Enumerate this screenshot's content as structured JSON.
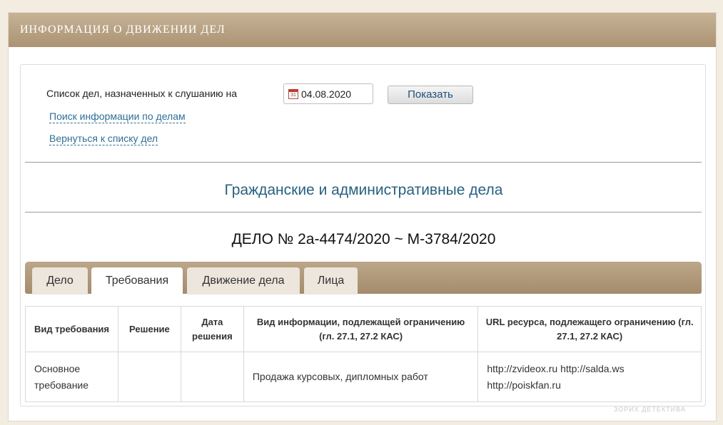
{
  "header": {
    "title": "ИНФОРМАЦИЯ О ДВИЖЕНИИ ДЕЛ"
  },
  "filter": {
    "label": "Список дел, назначенных к слушанию на",
    "date_value": "04.08.2020",
    "calendar_glyph": "31",
    "show_button": "Показать"
  },
  "links": {
    "search": "Поиск информации по делам",
    "back": "Вернуться к списку дел"
  },
  "section_title": "Гражданские и административные дела",
  "case_title": "ДЕЛО № 2а-4474/2020 ~ М-3784/2020",
  "tabs": [
    {
      "label": "Дело",
      "active": false
    },
    {
      "label": "Требования",
      "active": true
    },
    {
      "label": "Движение дела",
      "active": false
    },
    {
      "label": "Лица",
      "active": false
    }
  ],
  "table": {
    "headers": [
      "Вид требования",
      "Решение",
      "Дата решения",
      "Вид информации, подлежащей ограничению (гл. 27.1, 27.2 КАС)",
      "URL ресурса, подлежащего ограничению (гл. 27.1, 27.2 КАС)"
    ],
    "rows": [
      {
        "type": "Основное требование",
        "decision": "",
        "decision_date": "",
        "info_type": "Продажа курсовых, дипломных работ",
        "urls": "http://zvideox.ru http://salda.ws http://poiskfan.ru"
      }
    ]
  },
  "watermark": "ЗОРИХ ДЕТЕКТИВА",
  "colors": {
    "header_bar": "#b39d7e",
    "link": "#2e6f97",
    "section_title": "#27617f",
    "tab_bar": "#ad9576"
  }
}
